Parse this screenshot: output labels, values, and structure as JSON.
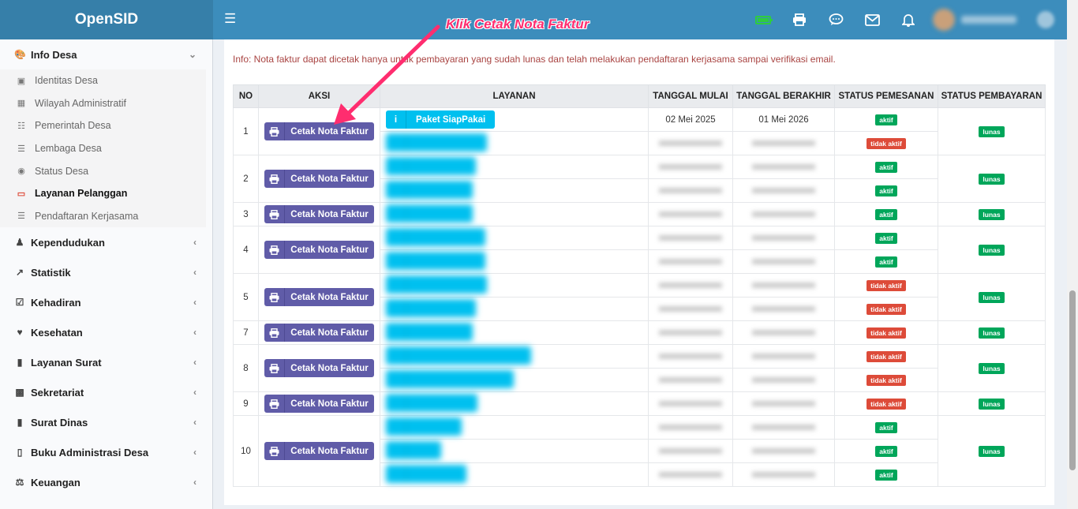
{
  "app": {
    "brand": "OpenSID"
  },
  "header": {
    "menu_icon": "bars-icon",
    "icons": [
      "battery-icon",
      "printer-icon",
      "chat-icon",
      "envelope-icon",
      "bell-icon"
    ]
  },
  "sidebar": {
    "sections": [
      {
        "label": "Info Desa",
        "icon": "palette-icon",
        "open": true,
        "items": [
          {
            "label": "Identitas Desa",
            "icon": "id-card-icon"
          },
          {
            "label": "Wilayah Administratif",
            "icon": "map-icon"
          },
          {
            "label": "Pemerintah Desa",
            "icon": "sitemap-icon"
          },
          {
            "label": "Lembaga Desa",
            "icon": "list-icon"
          },
          {
            "label": "Status Desa",
            "icon": "dot-circle-icon"
          },
          {
            "label": "Layanan Pelanggan",
            "icon": "credit-card-icon",
            "active": true
          },
          {
            "label": "Pendaftaran Kerjasama",
            "icon": "list-icon"
          }
        ]
      },
      {
        "label": "Kependudukan",
        "icon": "users-icon"
      },
      {
        "label": "Statistik",
        "icon": "line-chart-icon"
      },
      {
        "label": "Kehadiran",
        "icon": "calendar-check-icon"
      },
      {
        "label": "Kesehatan",
        "icon": "heartbeat-icon"
      },
      {
        "label": "Layanan Surat",
        "icon": "book-icon"
      },
      {
        "label": "Sekretariat",
        "icon": "archive-icon"
      },
      {
        "label": "Surat Dinas",
        "icon": "book-icon"
      },
      {
        "label": "Buku Administrasi Desa",
        "icon": "file-icon"
      },
      {
        "label": "Keuangan",
        "icon": "balance-scale-icon"
      }
    ]
  },
  "content": {
    "info": "Info: Nota faktur dapat dicetak hanya untuk pembayaran yang sudah lunas dan telah melakukan pendaftaran kerjasama sampai verifikasi email.",
    "annotation": "Klik Cetak Nota Faktur",
    "columns": [
      "NO",
      "AKSI",
      "LAYANAN",
      "TANGGAL MULAI",
      "TANGGAL BERAKHIR",
      "STATUS PEMESANAN",
      "STATUS PEMBAYARAN"
    ],
    "action_label": "Cetak Nota Faktur",
    "groups": [
      {
        "no": "1",
        "payment": "lunas",
        "rows": [
          {
            "layanan": "Paket SiapPakai",
            "mulai": "02 Mei 2025",
            "berakhir": "01 Mei 2026",
            "status": "aktif"
          },
          {
            "layanan": "",
            "mulai": "",
            "berakhir": "",
            "status": "tidak aktif"
          }
        ]
      },
      {
        "no": "2",
        "payment": "lunas",
        "rows": [
          {
            "layanan": "",
            "mulai": "",
            "berakhir": "",
            "status": "aktif"
          },
          {
            "layanan": "",
            "mulai": "",
            "berakhir": "",
            "status": "aktif"
          }
        ]
      },
      {
        "no": "3",
        "payment": "lunas",
        "rows": [
          {
            "layanan": "",
            "mulai": "",
            "berakhir": "",
            "status": "aktif"
          }
        ]
      },
      {
        "no": "4",
        "payment": "lunas",
        "rows": [
          {
            "layanan": "",
            "mulai": "",
            "berakhir": "",
            "status": "aktif"
          },
          {
            "layanan": "",
            "mulai": "",
            "berakhir": "",
            "status": "aktif"
          }
        ]
      },
      {
        "no": "5",
        "payment": "lunas",
        "rows": [
          {
            "layanan": "",
            "mulai": "",
            "berakhir": "",
            "status": "tidak aktif"
          },
          {
            "layanan": "",
            "mulai": "",
            "berakhir": "",
            "status": "tidak aktif"
          }
        ]
      },
      {
        "no": "7",
        "payment": "lunas",
        "rows": [
          {
            "layanan": "",
            "mulai": "",
            "berakhir": "",
            "status": "tidak aktif"
          }
        ]
      },
      {
        "no": "8",
        "payment": "lunas",
        "rows": [
          {
            "layanan": "",
            "mulai": "",
            "berakhir": "",
            "status": "tidak aktif"
          },
          {
            "layanan": "",
            "mulai": "",
            "berakhir": "",
            "status": "tidak aktif"
          }
        ]
      },
      {
        "no": "9",
        "payment": "lunas",
        "rows": [
          {
            "layanan": "",
            "mulai": "",
            "berakhir": "",
            "status": "tidak aktif"
          }
        ]
      },
      {
        "no": "10",
        "payment": "lunas",
        "rows": [
          {
            "layanan": "",
            "mulai": "",
            "berakhir": "",
            "status": "aktif"
          },
          {
            "layanan": "",
            "mulai": "",
            "berakhir": "",
            "status": "aktif"
          },
          {
            "layanan": "",
            "mulai": "",
            "berakhir": "",
            "status": "aktif"
          }
        ]
      }
    ]
  },
  "colors": {
    "primary": "#3c8dbc",
    "brand_dark": "#367fa9",
    "print_button": "#605ca8",
    "layanan_button": "#00c0ef",
    "aktif": "#00a65a",
    "tidak_aktif": "#dd4b39",
    "annotation": "#ff2d6f"
  }
}
